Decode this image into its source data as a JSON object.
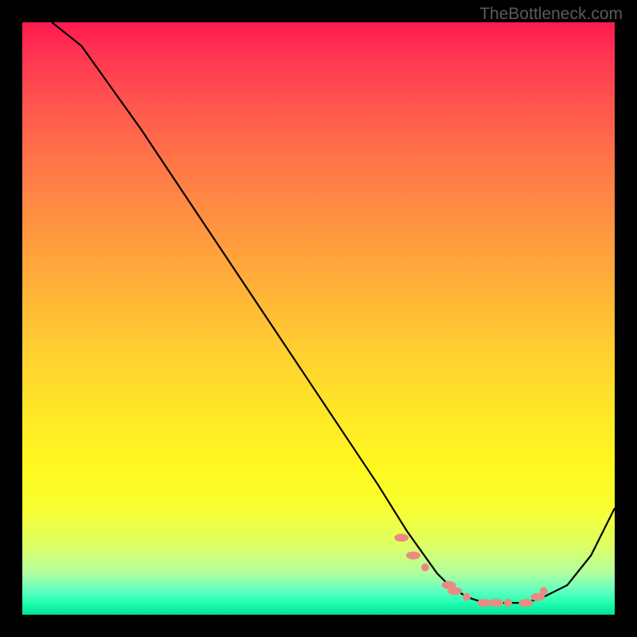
{
  "watermark": "TheBottleneck.com",
  "chart_data": {
    "type": "line",
    "title": "",
    "xlabel": "",
    "ylabel": "",
    "xlim": [
      0,
      100
    ],
    "ylim": [
      0,
      100
    ],
    "series": [
      {
        "name": "curve",
        "x": [
          5,
          10,
          20,
          30,
          40,
          50,
          60,
          65,
          70,
          72,
          75,
          78,
          80,
          82,
          85,
          88,
          92,
          96,
          100
        ],
        "y": [
          100,
          96,
          82,
          67,
          52,
          37,
          22,
          14,
          7,
          5,
          3,
          2,
          2,
          2,
          2,
          3,
          5,
          10,
          18
        ]
      }
    ],
    "markers": [
      {
        "x": 64,
        "y": 13
      },
      {
        "x": 66,
        "y": 10
      },
      {
        "x": 68,
        "y": 8
      },
      {
        "x": 72,
        "y": 5
      },
      {
        "x": 73,
        "y": 4
      },
      {
        "x": 75,
        "y": 3
      },
      {
        "x": 78,
        "y": 2
      },
      {
        "x": 80,
        "y": 2
      },
      {
        "x": 82,
        "y": 2
      },
      {
        "x": 85,
        "y": 2
      },
      {
        "x": 87,
        "y": 3
      },
      {
        "x": 88,
        "y": 4
      }
    ],
    "gradient_bands": [
      {
        "color": "#ff1a4d",
        "position": 0
      },
      {
        "color": "#ff9640",
        "position": 35
      },
      {
        "color": "#ffe528",
        "position": 65
      },
      {
        "color": "#00e090",
        "position": 100
      }
    ]
  }
}
